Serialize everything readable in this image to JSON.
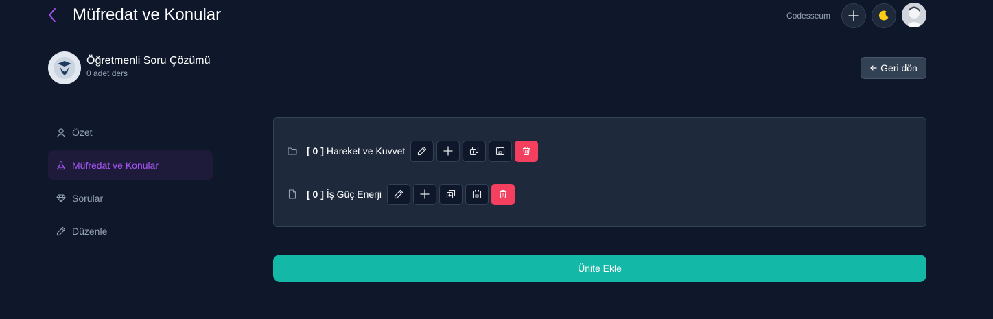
{
  "header": {
    "title": "Müfredat ve Konular",
    "brand": "Codesseum",
    "back_icon": "chevron-left-icon",
    "actions": [
      "plus-icon",
      "moon-icon",
      "avatar"
    ]
  },
  "course": {
    "title": "Öğretmenli Soru Çözümü",
    "subtitle": "0 adet ders",
    "back_label": "Geri dön"
  },
  "sidebar": {
    "items": [
      {
        "label": "Özet",
        "icon": "user-icon"
      },
      {
        "label": "Müfredat ve Konular",
        "icon": "flask-icon",
        "active": true
      },
      {
        "label": "Sorular",
        "icon": "diamond-icon"
      },
      {
        "label": "Düzenle",
        "icon": "pencil-icon"
      }
    ]
  },
  "units": [
    {
      "count": "[ 0 ]",
      "label": "Hareket ve Kuvvet",
      "icon": "folder-icon"
    },
    {
      "count": "[ 0 ]",
      "label": "İş Güç Enerji",
      "icon": "file-icon"
    }
  ],
  "add_unit_label": "Ünite Ekle",
  "colors": {
    "background": "#0f172a",
    "panel": "#1e293b",
    "accent_purple": "#a855f7",
    "teal": "#14b8a6",
    "danger": "#f43f5e",
    "moon": "#facc15"
  }
}
